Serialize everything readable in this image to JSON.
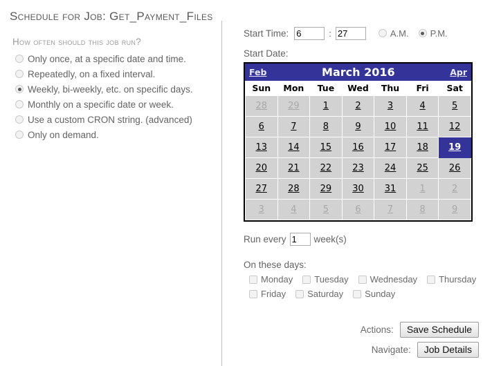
{
  "page_title": "Schedule for Job: Get_Payment_Files",
  "frequency": {
    "legend": "How often should this job run?",
    "options": [
      {
        "label": "Only once, at a specific date and time.",
        "selected": false
      },
      {
        "label": "Repeatedly, on a fixed interval.",
        "selected": false
      },
      {
        "label": "Weekly, bi-weekly, etc. on specific days.",
        "selected": true
      },
      {
        "label": "Monthly on a specific date or week.",
        "selected": false
      },
      {
        "label": "Use a custom CRON string. (advanced)",
        "selected": false
      },
      {
        "label": "Only on demand.",
        "selected": false
      }
    ]
  },
  "start_time": {
    "label": "Start Time:",
    "hour": "6",
    "separator": ":",
    "minute": "27",
    "am_label": "A.M.",
    "pm_label": "P.M.",
    "am_selected": false,
    "pm_selected": true
  },
  "start_date": {
    "label": "Start Date:"
  },
  "calendar": {
    "prev_label": "Feb",
    "next_label": "Apr",
    "title": "March 2016",
    "header_bg": "#333399",
    "selected_bg": "#333399",
    "cell_bg": "#d2d2d2",
    "weekdays": [
      "Sun",
      "Mon",
      "Tue",
      "Wed",
      "Thu",
      "Fri",
      "Sat"
    ],
    "weeks": [
      [
        {
          "day": "28",
          "other": true,
          "selected": false
        },
        {
          "day": "29",
          "other": true,
          "selected": false
        },
        {
          "day": "1",
          "other": false,
          "selected": false
        },
        {
          "day": "2",
          "other": false,
          "selected": false
        },
        {
          "day": "3",
          "other": false,
          "selected": false
        },
        {
          "day": "4",
          "other": false,
          "selected": false
        },
        {
          "day": "5",
          "other": false,
          "selected": false
        }
      ],
      [
        {
          "day": "6",
          "other": false,
          "selected": false
        },
        {
          "day": "7",
          "other": false,
          "selected": false
        },
        {
          "day": "8",
          "other": false,
          "selected": false
        },
        {
          "day": "9",
          "other": false,
          "selected": false
        },
        {
          "day": "10",
          "other": false,
          "selected": false
        },
        {
          "day": "11",
          "other": false,
          "selected": false
        },
        {
          "day": "12",
          "other": false,
          "selected": false
        }
      ],
      [
        {
          "day": "13",
          "other": false,
          "selected": false
        },
        {
          "day": "14",
          "other": false,
          "selected": false
        },
        {
          "day": "15",
          "other": false,
          "selected": false
        },
        {
          "day": "16",
          "other": false,
          "selected": false
        },
        {
          "day": "17",
          "other": false,
          "selected": false
        },
        {
          "day": "18",
          "other": false,
          "selected": false
        },
        {
          "day": "19",
          "other": false,
          "selected": true
        }
      ],
      [
        {
          "day": "20",
          "other": false,
          "selected": false
        },
        {
          "day": "21",
          "other": false,
          "selected": false
        },
        {
          "day": "22",
          "other": false,
          "selected": false
        },
        {
          "day": "23",
          "other": false,
          "selected": false
        },
        {
          "day": "24",
          "other": false,
          "selected": false
        },
        {
          "day": "25",
          "other": false,
          "selected": false
        },
        {
          "day": "26",
          "other": false,
          "selected": false
        }
      ],
      [
        {
          "day": "27",
          "other": false,
          "selected": false
        },
        {
          "day": "28",
          "other": false,
          "selected": false
        },
        {
          "day": "29",
          "other": false,
          "selected": false
        },
        {
          "day": "30",
          "other": false,
          "selected": false
        },
        {
          "day": "31",
          "other": false,
          "selected": false
        },
        {
          "day": "1",
          "other": true,
          "selected": false
        },
        {
          "day": "2",
          "other": true,
          "selected": false
        }
      ],
      [
        {
          "day": "3",
          "other": true,
          "selected": false
        },
        {
          "day": "4",
          "other": true,
          "selected": false
        },
        {
          "day": "5",
          "other": true,
          "selected": false
        },
        {
          "day": "6",
          "other": true,
          "selected": false
        },
        {
          "day": "7",
          "other": true,
          "selected": false
        },
        {
          "day": "8",
          "other": true,
          "selected": false
        },
        {
          "day": "9",
          "other": true,
          "selected": false
        }
      ]
    ]
  },
  "run_every": {
    "prefix": "Run every",
    "value": "1",
    "suffix": "week(s)"
  },
  "on_these_days": {
    "label": "On these days:",
    "row1": [
      {
        "label": "Monday",
        "checked": false
      },
      {
        "label": "Tuesday",
        "checked": false
      },
      {
        "label": "Wednesday",
        "checked": false
      },
      {
        "label": "Thursday",
        "checked": false
      }
    ],
    "row2": [
      {
        "label": "Friday",
        "checked": false
      },
      {
        "label": "Saturday",
        "checked": false
      },
      {
        "label": "Sunday",
        "checked": false
      }
    ]
  },
  "actions": {
    "actions_label": "Actions:",
    "save_button": "Save Schedule",
    "navigate_label": "Navigate:",
    "job_details_button": "Job Details"
  }
}
